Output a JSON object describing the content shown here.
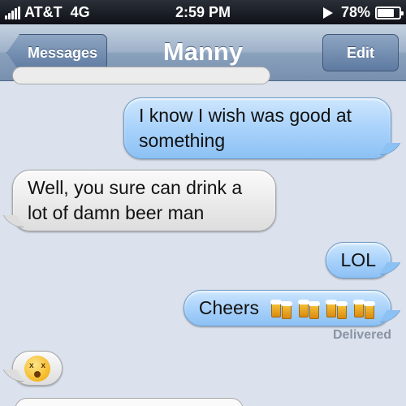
{
  "status_bar": {
    "carrier": "AT&T",
    "network": "4G",
    "time": "2:59 PM",
    "battery": "78%",
    "battery_level": 0.78,
    "icons": [
      "signal-bars-icon",
      "play-icon",
      "battery-icon"
    ]
  },
  "nav": {
    "back_label": "Messages",
    "title": "Manny",
    "edit_label": "Edit"
  },
  "messages": [
    {
      "direction": "outgoing",
      "text": "I know I wish was good at something"
    },
    {
      "direction": "incoming",
      "text": "Well, you sure can drink a lot of damn beer man"
    },
    {
      "direction": "outgoing",
      "text": "LOL"
    },
    {
      "direction": "outgoing",
      "text": "Cheers",
      "emoji": [
        "beers-icon",
        "beers-icon",
        "beers-icon",
        "beers-icon"
      ]
    },
    {
      "direction": "incoming",
      "emoji": [
        "dizzy-face-icon"
      ]
    }
  ],
  "delivery_status": "Delivered",
  "colors": {
    "outgoing_bubble": "#a9d2fb",
    "incoming_bubble": "#ececec",
    "background": "#dbe2ed",
    "nav_bar": "#8aa1bd"
  }
}
